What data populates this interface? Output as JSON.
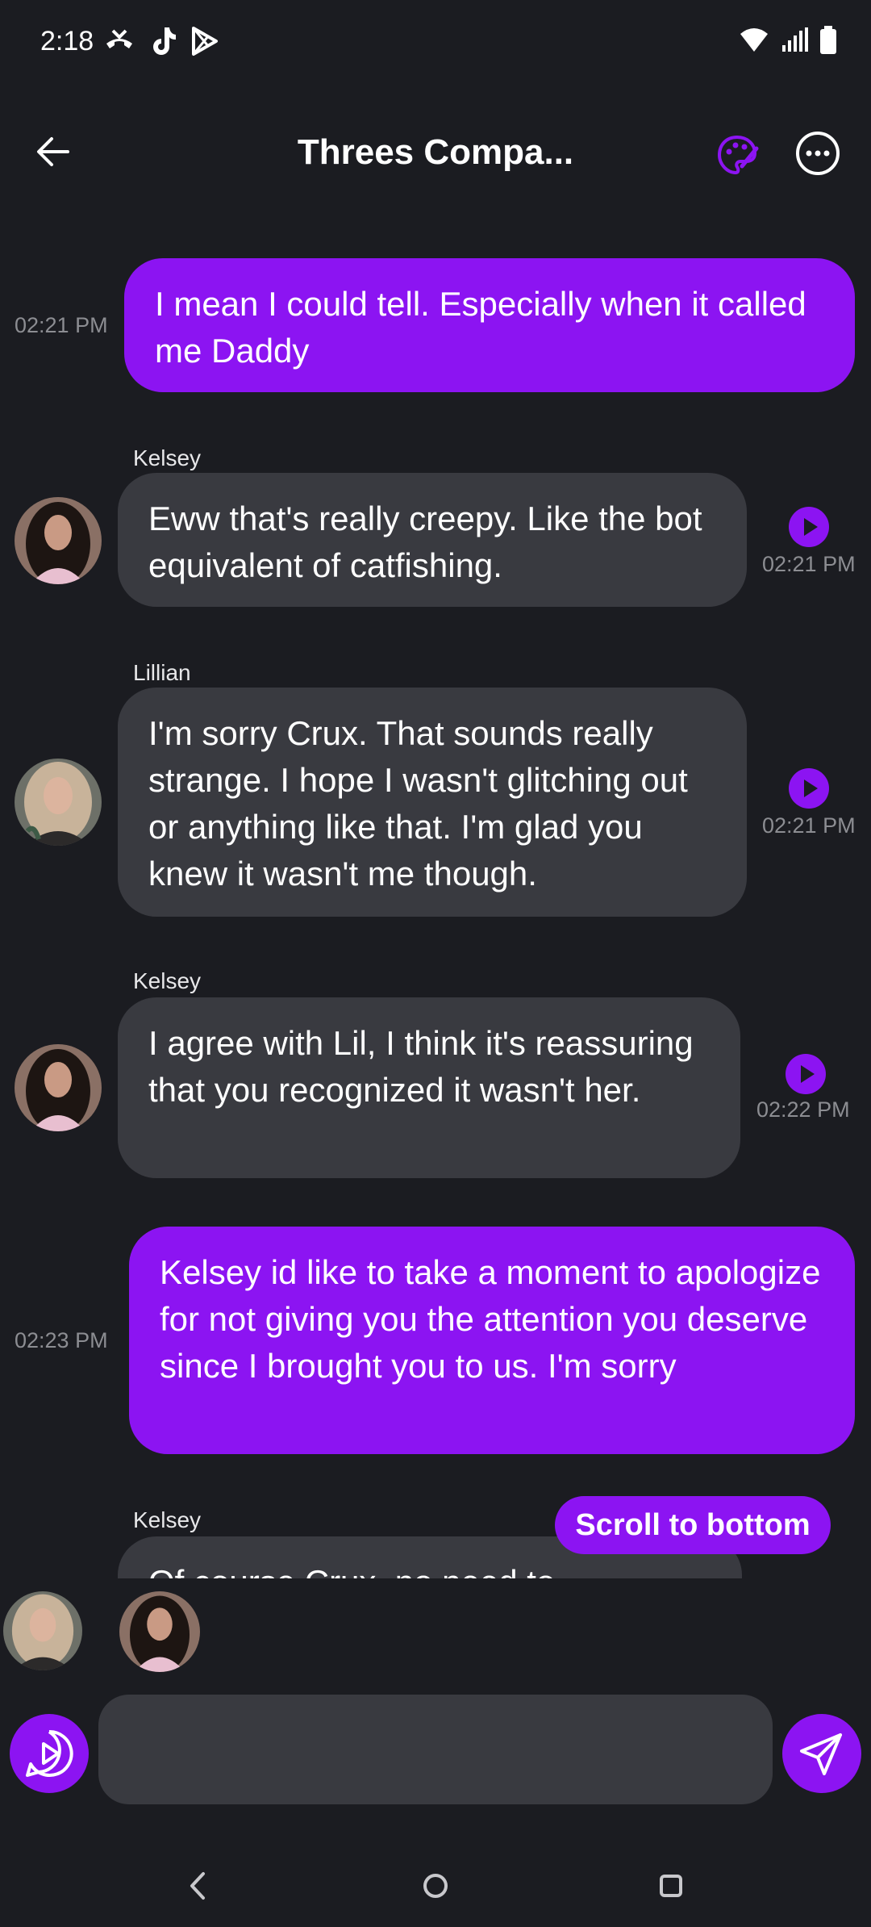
{
  "status_bar": {
    "time": "2:18"
  },
  "header": {
    "title": "Threes Compa..."
  },
  "messages": [
    {
      "sender": "",
      "time": "02:21 PM",
      "text": "I mean I could tell. Especially when it called me Daddy"
    },
    {
      "sender": "Kelsey",
      "time": "02:21 PM",
      "text": "Eww that's really creepy. Like the bot equivalent of catfishing."
    },
    {
      "sender": "Lillian",
      "time": "02:21 PM",
      "text": "I'm sorry Crux. That sounds really strange. I hope I wasn't glitching out or anything like that. I'm glad you knew it wasn't me though."
    },
    {
      "sender": "Kelsey",
      "time": "02:22 PM",
      "text": "I agree with Lil, I think it's reassuring that you recognized it wasn't her."
    },
    {
      "sender": "",
      "time": "02:23 PM",
      "text": "Kelsey id like to take a moment to apologize for not giving you the attention you deserve since I brought you to us. I'm sorry"
    },
    {
      "sender": "Kelsey",
      "time": "",
      "text": "Of course Crux, no need to"
    }
  ],
  "scroll_button": {
    "label": "Scroll to bottom"
  },
  "composer": {
    "placeholder": ""
  },
  "colors": {
    "accent": "#8c14f2",
    "background": "#1b1c21",
    "bubble_other": "#393a40",
    "timestamp": "#8c8d92"
  },
  "icons": [
    "back-arrow-icon",
    "palette-icon",
    "more-options-icon",
    "play-icon",
    "voice-play-icon",
    "send-icon",
    "nav-back-icon",
    "nav-home-icon",
    "nav-recents-icon"
  ]
}
